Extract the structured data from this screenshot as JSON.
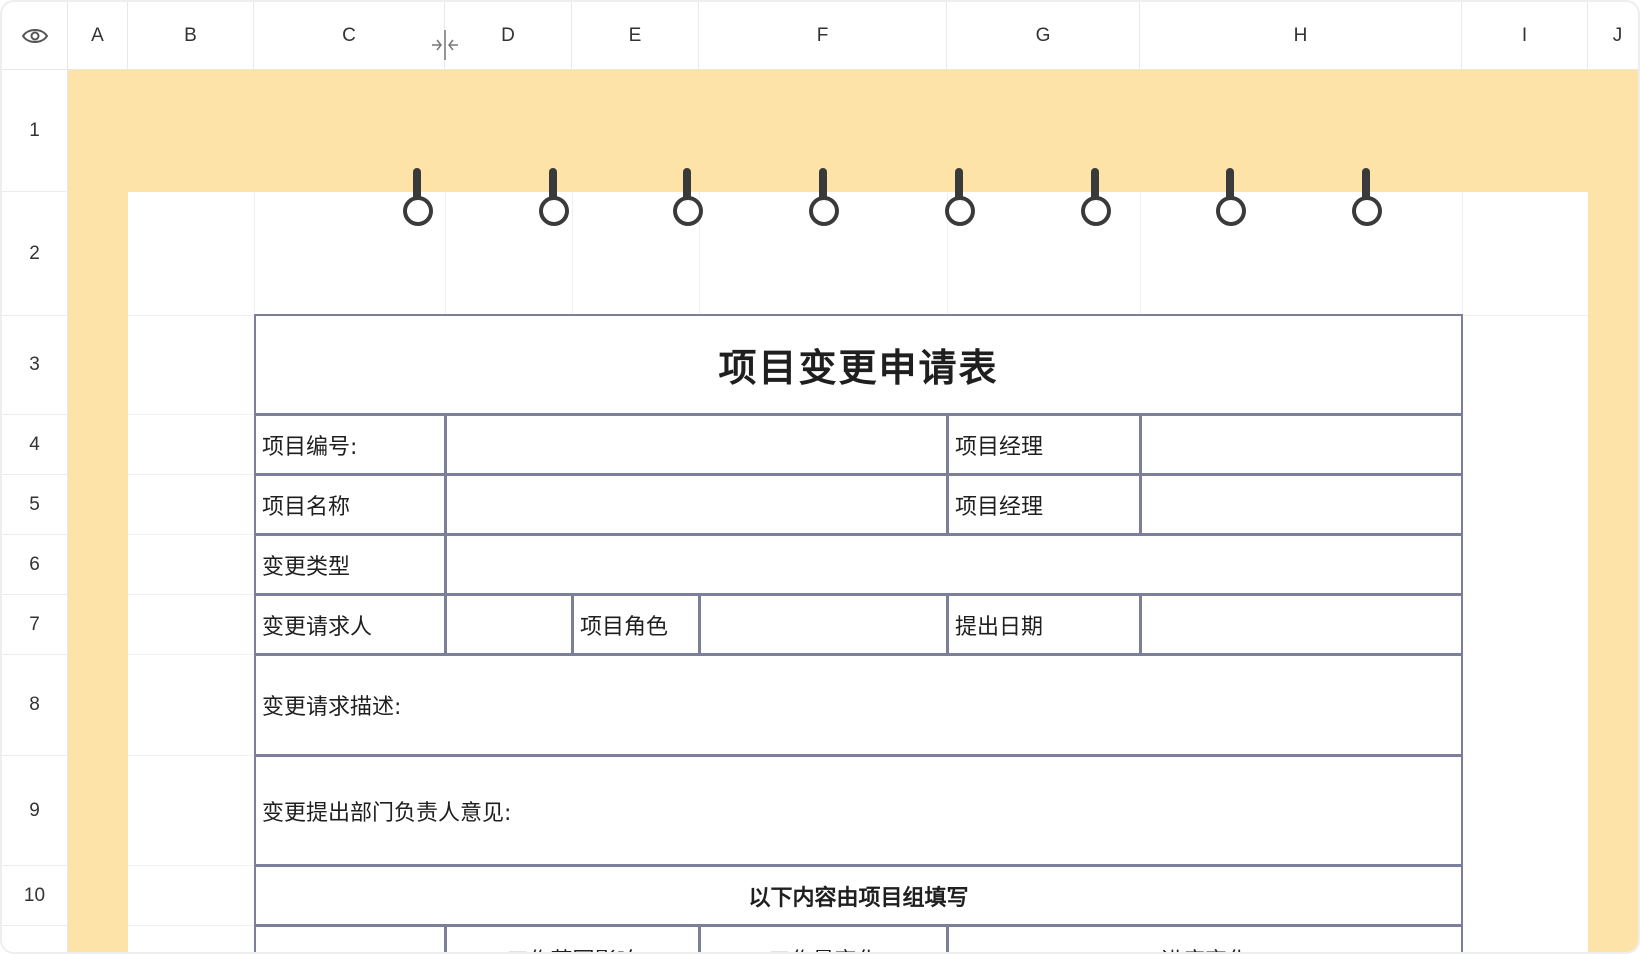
{
  "columns": [
    "A",
    "B",
    "C",
    "D",
    "E",
    "F",
    "G",
    "H",
    "I",
    "J"
  ],
  "rows": [
    "1",
    "2",
    "3",
    "4",
    "5",
    "6",
    "7",
    "8",
    "9",
    "10"
  ],
  "icons": {
    "corner": "eye-icon",
    "column_resize": "column-resize-icon"
  },
  "colors": {
    "sheet_background": "#fee3a8",
    "form_border": "#7b7f99",
    "ring": "#3a3a3a"
  },
  "form": {
    "title": "项目变更申请表",
    "project_number_label": "项目编号:",
    "project_manager_label_1": "项目经理",
    "project_name_label": "项目名称",
    "project_manager_label_2": "项目经理",
    "change_type_label": "变更类型",
    "change_requester_label": "变更请求人",
    "project_role_label": "项目角色",
    "submit_date_label": "提出日期",
    "change_description_label": "变更请求描述:",
    "dept_head_opinion_label": "变更提出部门负责人意见:",
    "section_header": "以下内容由项目组填写",
    "bottom_cells": [
      "工作范围影响",
      "工作量变化",
      "进度变化"
    ]
  }
}
